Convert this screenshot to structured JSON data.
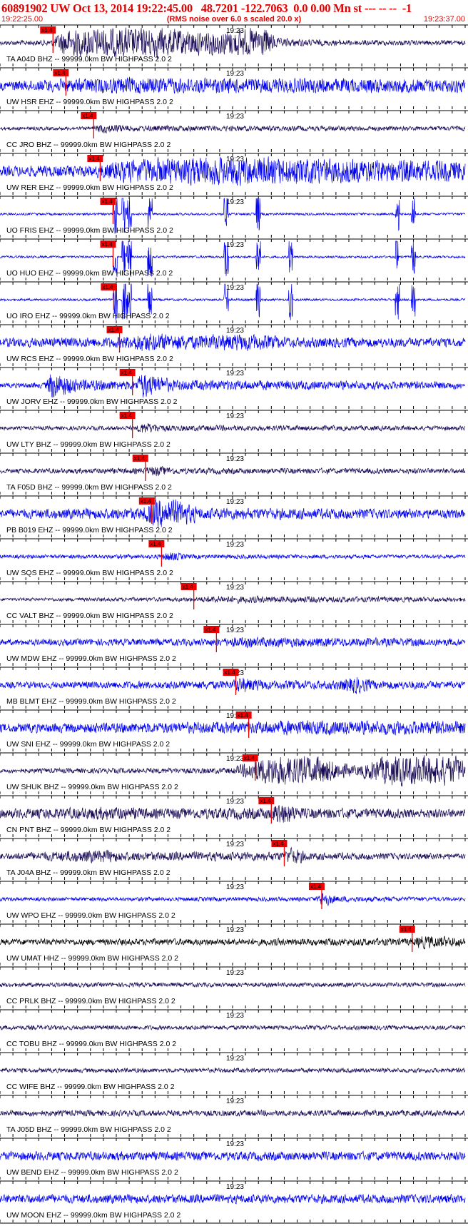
{
  "header": {
    "title": "60891902 UW Oct 13, 2014 19:22:45.00   48.7201 -122.7063  0.0 0.00 Mn st --- -- --  -1",
    "start_time": "19:22:25.00",
    "end_time": "19:23:37.00",
    "rms_note": "(RMS noise over 6.0 s scaled 20.0 x)"
  },
  "chart_data": {
    "type": "line",
    "title": "60891902 UW Oct 13, 2014 19:22:45.00   48.7201 -122.7063  0.0 0.00 Mn st --- -- --  -1",
    "x_axis": {
      "start": "19:22:25.00",
      "end": "19:23:37.00",
      "duration_s": 72,
      "tick_interval_s": 2,
      "major_label": "19:23",
      "major_label_time_s": 35
    },
    "grid": false,
    "colors": {
      "header": "#e00000",
      "blue": "#0000ee",
      "navy": "#1a0a55",
      "black": "#000000",
      "marker": "#ee0000",
      "axis": "#000000"
    },
    "marker_label": "x1.4",
    "traces": [
      {
        "label": "TA A04D BHZ -- 99999.0km BW  HIGHPASS  2.0  2",
        "color": "navy",
        "pick_s": 8.2,
        "envelope": [
          [
            0,
            0.15
          ],
          [
            8,
            0.2
          ],
          [
            10,
            0.9
          ],
          [
            18,
            1.0
          ],
          [
            24,
            1.0
          ],
          [
            28,
            0.9
          ],
          [
            33,
            0.8
          ],
          [
            41,
            1.0
          ],
          [
            43,
            0.3
          ],
          [
            50,
            0.2
          ],
          [
            72,
            0.15
          ]
        ]
      },
      {
        "label": "UW HSR EHZ -- 99999.0km BW  HIGHPASS  2.0  2",
        "color": "blue",
        "pick_s": 10.2,
        "envelope": [
          [
            0,
            0.3
          ],
          [
            10,
            0.45
          ],
          [
            20,
            0.55
          ],
          [
            40,
            0.5
          ],
          [
            72,
            0.45
          ]
        ]
      },
      {
        "label": "CC JRO BHZ -- 99999.0km BW  HIGHPASS  2.0  2",
        "color": "navy",
        "pick_s": 14.5,
        "envelope": [
          [
            0,
            0.12
          ],
          [
            14,
            0.12
          ],
          [
            16,
            0.35
          ],
          [
            20,
            0.2
          ],
          [
            72,
            0.15
          ]
        ]
      },
      {
        "label": "UW RER EHZ -- 99999.0km BW  HIGHPASS  2.0  2",
        "color": "blue",
        "pick_s": 15.5,
        "envelope": [
          [
            0,
            0.35
          ],
          [
            15,
            0.4
          ],
          [
            18,
            0.7
          ],
          [
            30,
            1.0
          ],
          [
            50,
            0.85
          ],
          [
            72,
            0.7
          ]
        ]
      },
      {
        "label": "UO FRIS EHZ -- 99999.0km BW  HIGHPASS  2.0  2",
        "color": "blue",
        "pick_s": 17.5,
        "envelope": [
          [
            0,
            0.08
          ],
          [
            72,
            0.08
          ]
        ],
        "spikes": [
          17.8,
          19.2,
          20.0,
          23.2,
          35.0,
          40.0,
          61.5,
          64.0
        ]
      },
      {
        "label": "UO HUO EHZ -- 99999.0km BW  HIGHPASS  2.0  2",
        "color": "blue",
        "pick_s": 17.5,
        "envelope": [
          [
            0,
            0.08
          ],
          [
            72,
            0.08
          ]
        ],
        "spikes": [
          17.8,
          19.2,
          20.0,
          23.2,
          35.0,
          40.0,
          45.0,
          61.5,
          64.0
        ]
      },
      {
        "label": "UO IRO EHZ -- 99999.0km BW  HIGHPASS  2.0  2",
        "color": "blue",
        "pick_s": 17.6,
        "envelope": [
          [
            0,
            0.08
          ],
          [
            72,
            0.08
          ]
        ],
        "spikes": [
          17.8,
          19.2,
          20.0,
          23.2,
          35.0,
          40.0,
          45.0,
          61.5,
          64.0
        ]
      },
      {
        "label": "UW RCS EHZ -- 99999.0km BW  HIGHPASS  2.0  2",
        "color": "blue",
        "pick_s": 18.5,
        "envelope": [
          [
            0,
            0.3
          ],
          [
            18,
            0.35
          ],
          [
            22,
            0.65
          ],
          [
            30,
            0.5
          ],
          [
            38,
            0.6
          ],
          [
            45,
            0.35
          ],
          [
            72,
            0.3
          ]
        ]
      },
      {
        "label": "UW JORV EHZ -- 99999.0km BW  HIGHPASS  2.0  2",
        "color": "blue",
        "pick_s": 20.5,
        "envelope": [
          [
            0,
            0.15
          ],
          [
            7,
            0.2
          ],
          [
            8,
            1.0
          ],
          [
            12,
            0.4
          ],
          [
            21,
            0.3
          ],
          [
            22,
            0.9
          ],
          [
            27,
            0.35
          ],
          [
            72,
            0.25
          ]
        ]
      },
      {
        "label": "UW LTY BHZ -- 99999.0km BW  HIGHPASS  2.0  2",
        "color": "navy",
        "pick_s": 20.5,
        "envelope": [
          [
            0,
            0.12
          ],
          [
            21,
            0.15
          ],
          [
            22,
            0.4
          ],
          [
            26,
            0.2
          ],
          [
            72,
            0.15
          ]
        ]
      },
      {
        "label": "TA F05D BHZ -- 99999.0km BW  HIGHPASS  2.0  2",
        "color": "navy",
        "pick_s": 22.5,
        "envelope": [
          [
            0,
            0.15
          ],
          [
            22,
            0.2
          ],
          [
            24,
            0.35
          ],
          [
            28,
            0.2
          ],
          [
            72,
            0.18
          ]
        ]
      },
      {
        "label": "PB B019 EHZ -- 99999.0km BW  HIGHPASS  2.0  2",
        "color": "blue",
        "pick_s": 23.5,
        "envelope": [
          [
            0,
            0.3
          ],
          [
            22,
            0.4
          ],
          [
            24,
            1.0
          ],
          [
            28,
            0.9
          ],
          [
            31,
            0.4
          ],
          [
            72,
            0.3
          ]
        ]
      },
      {
        "label": "UW SQS EHZ -- 99999.0km BW  HIGHPASS  2.0  2",
        "color": "blue",
        "pick_s": 25.0,
        "envelope": [
          [
            0,
            0.12
          ],
          [
            25,
            0.15
          ],
          [
            26,
            0.35
          ],
          [
            29,
            0.15
          ],
          [
            72,
            0.12
          ]
        ]
      },
      {
        "label": "CC VALT BHZ -- 99999.0km BW  HIGHPASS  2.0  2",
        "color": "navy",
        "pick_s": 30.0,
        "envelope": [
          [
            0,
            0.1
          ],
          [
            30,
            0.15
          ],
          [
            33,
            0.25
          ],
          [
            72,
            0.15
          ]
        ]
      },
      {
        "label": "UW MDW EHZ -- 99999.0km BW  HIGHPASS  2.0  2",
        "color": "blue",
        "pick_s": 33.5,
        "envelope": [
          [
            0,
            0.2
          ],
          [
            34,
            0.25
          ],
          [
            36,
            0.35
          ],
          [
            72,
            0.25
          ]
        ]
      },
      {
        "label": "MB BLMT EHZ -- 99999.0km BW  HIGHPASS  2.0  2",
        "color": "blue",
        "pick_s": 36.5,
        "envelope": [
          [
            0,
            0.2
          ],
          [
            36,
            0.3
          ],
          [
            37,
            0.55
          ],
          [
            42,
            0.3
          ],
          [
            52,
            0.3
          ],
          [
            55,
            0.6
          ],
          [
            58,
            0.3
          ],
          [
            72,
            0.25
          ]
        ]
      },
      {
        "label": "UW SNI EHZ -- 99999.0km BW  HIGHPASS  2.0  2",
        "color": "blue",
        "pick_s": 38.5,
        "envelope": [
          [
            0,
            0.3
          ],
          [
            38,
            0.4
          ],
          [
            45,
            0.5
          ],
          [
            72,
            0.45
          ]
        ]
      },
      {
        "label": "UW SHUK BHZ -- 99999.0km BW  HIGHPASS  2.0  2",
        "color": "navy",
        "pick_s": 39.5,
        "envelope": [
          [
            0,
            0.15
          ],
          [
            36,
            0.2
          ],
          [
            40,
            0.8
          ],
          [
            42,
            1.0
          ],
          [
            50,
            0.9
          ],
          [
            55,
            0.3
          ],
          [
            60,
            1.0
          ],
          [
            68,
            1.0
          ],
          [
            72,
            0.9
          ]
        ]
      },
      {
        "label": "CN PNT BHZ -- 99999.0km BW  HIGHPASS  2.0  2",
        "color": "navy",
        "pick_s": 42.0,
        "envelope": [
          [
            0,
            0.3
          ],
          [
            18,
            0.45
          ],
          [
            24,
            0.35
          ],
          [
            42,
            0.4
          ],
          [
            43,
            0.85
          ],
          [
            47,
            0.35
          ],
          [
            72,
            0.3
          ]
        ]
      },
      {
        "label": "TA J04A BHZ -- 99999.0km BW  HIGHPASS  2.0  2",
        "color": "navy",
        "pick_s": 44.0,
        "envelope": [
          [
            0,
            0.2
          ],
          [
            16,
            0.45
          ],
          [
            20,
            0.3
          ],
          [
            44,
            0.3
          ],
          [
            45,
            0.6
          ],
          [
            48,
            0.25
          ],
          [
            72,
            0.2
          ]
        ]
      },
      {
        "label": "UW WPO EHZ -- 99999.0km BW  HIGHPASS  2.0  2",
        "color": "blue",
        "pick_s": 49.8,
        "envelope": [
          [
            0,
            0.12
          ],
          [
            49,
            0.15
          ],
          [
            50,
            0.6
          ],
          [
            52,
            0.2
          ],
          [
            72,
            0.12
          ]
        ]
      },
      {
        "label": "UW UMAT HHZ -- 99999.0km BW  HIGHPASS  2.0  2",
        "color": "black",
        "pick_s": 63.8,
        "envelope": [
          [
            0,
            0.2
          ],
          [
            64,
            0.25
          ],
          [
            65,
            0.45
          ],
          [
            72,
            0.3
          ]
        ]
      },
      {
        "label": "CC PRLK BHZ -- 99999.0km BW  HIGHPASS  2.0  2",
        "color": "navy",
        "pick_s": null,
        "envelope": [
          [
            0,
            0.15
          ],
          [
            72,
            0.15
          ]
        ]
      },
      {
        "label": "CC TOBU BHZ -- 99999.0km BW  HIGHPASS  2.0  2",
        "color": "navy",
        "pick_s": null,
        "envelope": [
          [
            0,
            0.15
          ],
          [
            72,
            0.15
          ]
        ]
      },
      {
        "label": "CC WIFE BHZ -- 99999.0km BW  HIGHPASS  2.0  2",
        "color": "navy",
        "pick_s": null,
        "envelope": [
          [
            0,
            0.15
          ],
          [
            72,
            0.15
          ]
        ]
      },
      {
        "label": "TA J05D BHZ -- 99999.0km BW  HIGHPASS  2.0  2",
        "color": "navy",
        "pick_s": null,
        "envelope": [
          [
            0,
            0.2
          ],
          [
            72,
            0.2
          ]
        ]
      },
      {
        "label": "UW BEND EHZ -- 99999.0km BW  HIGHPASS  2.0  2",
        "color": "blue",
        "pick_s": null,
        "envelope": [
          [
            0,
            0.3
          ],
          [
            72,
            0.3
          ]
        ]
      },
      {
        "label": "UW MOON EHZ -- 99999.0km BW  HIGHPASS  2.0  2",
        "color": "blue",
        "pick_s": null,
        "envelope": [
          [
            0,
            0.3
          ],
          [
            72,
            0.3
          ]
        ]
      }
    ]
  }
}
